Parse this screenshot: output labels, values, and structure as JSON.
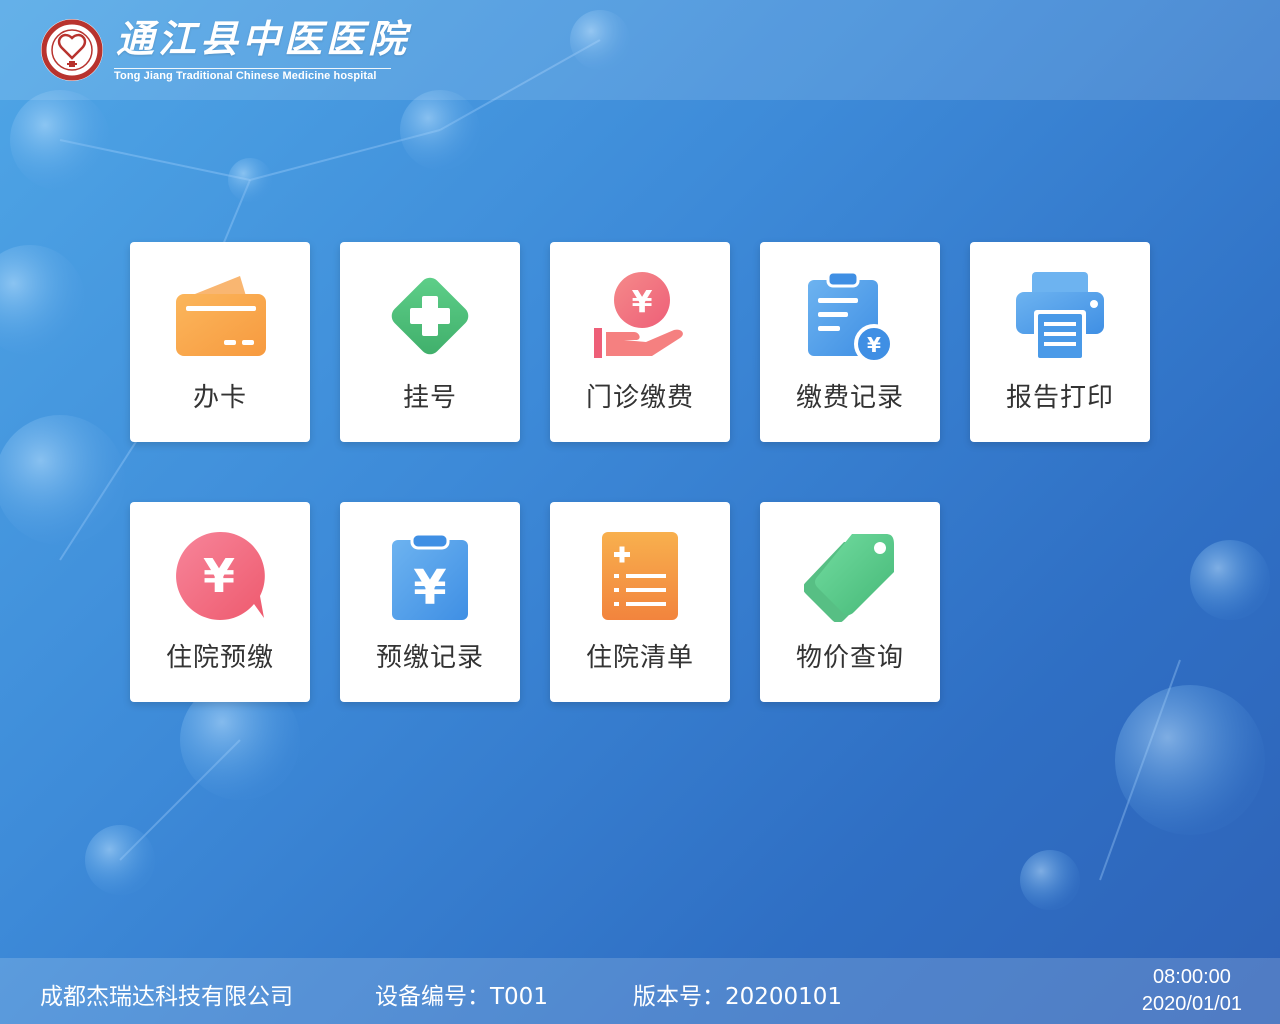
{
  "header": {
    "hospital_name": "通江县中医医院",
    "hospital_name_en": "Tong Jiang Traditional Chinese Medicine hospital"
  },
  "menu": {
    "row1": [
      {
        "label": "办卡",
        "icon": "card-icon"
      },
      {
        "label": "挂号",
        "icon": "medical-cross-icon"
      },
      {
        "label": "门诊缴费",
        "icon": "hand-yuan-icon"
      },
      {
        "label": "缴费记录",
        "icon": "payment-record-icon"
      },
      {
        "label": "报告打印",
        "icon": "printer-icon"
      }
    ],
    "row2": [
      {
        "label": "住院预缴",
        "icon": "yuan-bubble-icon"
      },
      {
        "label": "预缴记录",
        "icon": "clipboard-yuan-icon"
      },
      {
        "label": "住院清单",
        "icon": "list-icon"
      },
      {
        "label": "物价查询",
        "icon": "price-tag-icon"
      }
    ]
  },
  "footer": {
    "company": "成都杰瑞达科技有限公司",
    "device_label": "设备编号：",
    "device_id": "T001",
    "version_label": "版本号：",
    "version": "20200101",
    "time": "08:00:00",
    "date": "2020/01/01"
  },
  "colors": {
    "background": "#3d8ad8",
    "tile": "#ffffff",
    "orange": "#f9a24a",
    "green": "#4fbf7a",
    "pink": "#f2707f",
    "blue": "#4a9ae8"
  }
}
